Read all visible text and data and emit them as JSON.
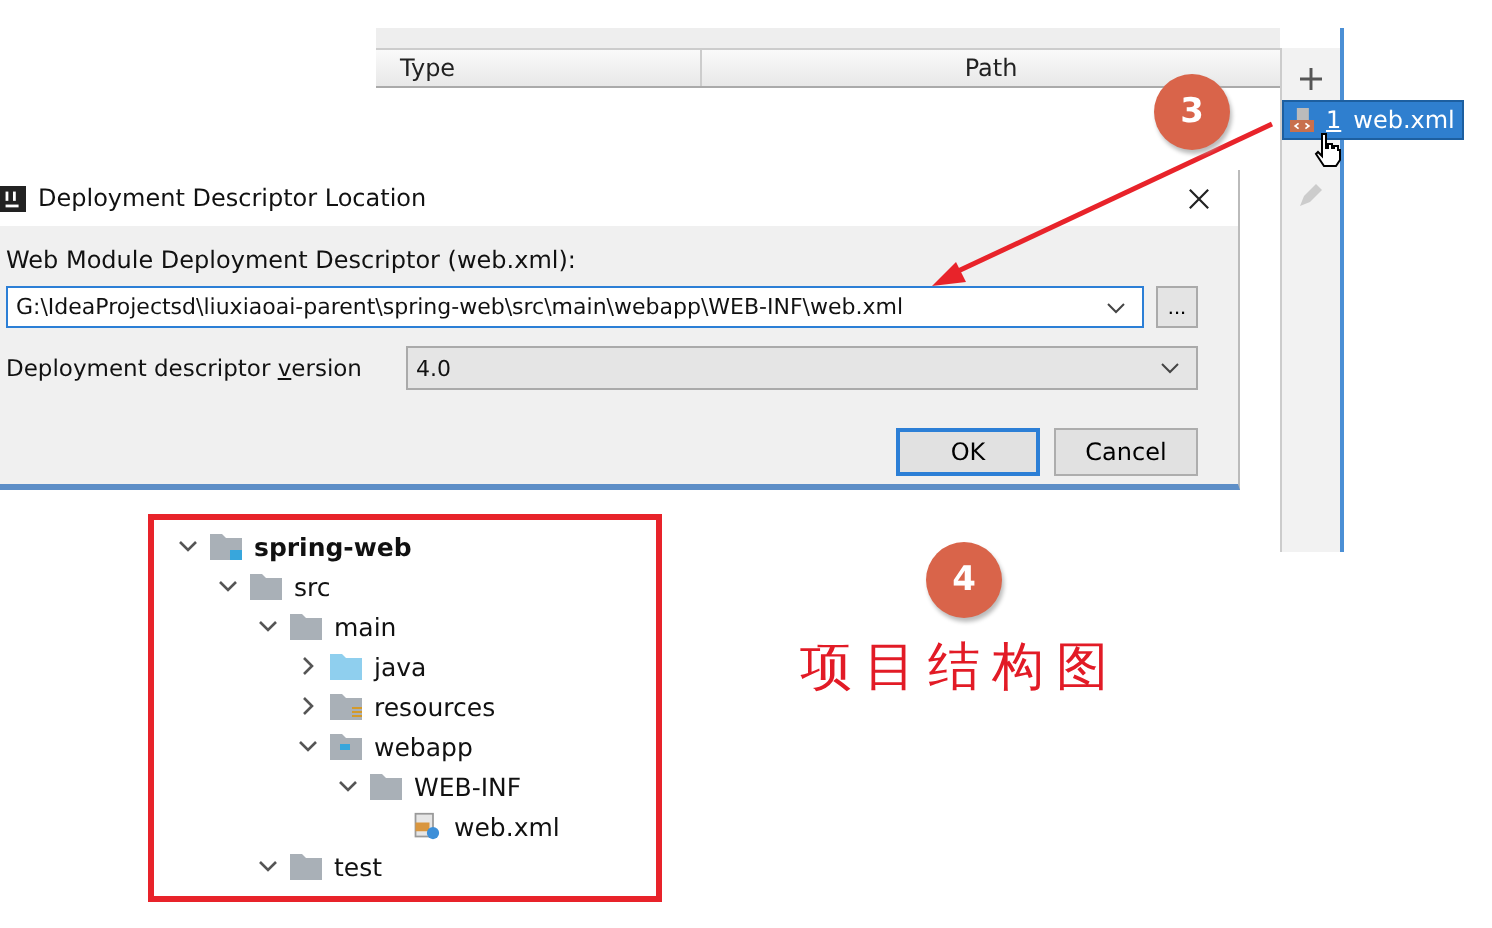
{
  "table": {
    "columns": [
      "Type",
      "Path"
    ]
  },
  "descriptor_list": {
    "items": [
      {
        "number": "1",
        "label": "web.xml",
        "selected": true
      }
    ]
  },
  "dialog": {
    "title": "Deployment Descriptor Location",
    "descriptor_label": "Web Module Deployment Descriptor (web.xml):",
    "descriptor_path": "G:\\IdeaProjectsd\\liuxiaoai-parent\\spring-web\\src\\main\\webapp\\WEB-INF\\web.xml",
    "browse_button": "...",
    "version_label": {
      "before": "Deployment descriptor ",
      "mnemonic": "v",
      "after": "ersion"
    },
    "version_value": "4.0",
    "buttons": [
      {
        "label": "OK",
        "default": true
      },
      {
        "label": "Cancel",
        "default": false
      }
    ]
  },
  "annotations": [
    {
      "number": "3"
    },
    {
      "number": "4"
    }
  ],
  "caption": "项目结构图",
  "project_tree": [
    {
      "label": "spring-web",
      "kind": "module",
      "expanded": true,
      "children": [
        {
          "label": "src",
          "kind": "folder",
          "expanded": true,
          "children": [
            {
              "label": "main",
              "kind": "folder",
              "expanded": true,
              "children": [
                {
                  "label": "java",
                  "kind": "source",
                  "expanded": false
                },
                {
                  "label": "resources",
                  "kind": "resources",
                  "expanded": false
                },
                {
                  "label": "webapp",
                  "kind": "web",
                  "expanded": true,
                  "children": [
                    {
                      "label": "WEB-INF",
                      "kind": "folder",
                      "expanded": true,
                      "children": [
                        {
                          "label": "web.xml",
                          "kind": "xml"
                        }
                      ]
                    }
                  ]
                }
              ]
            },
            {
              "label": "test",
              "kind": "folder",
              "expanded": true
            }
          ]
        }
      ]
    }
  ]
}
